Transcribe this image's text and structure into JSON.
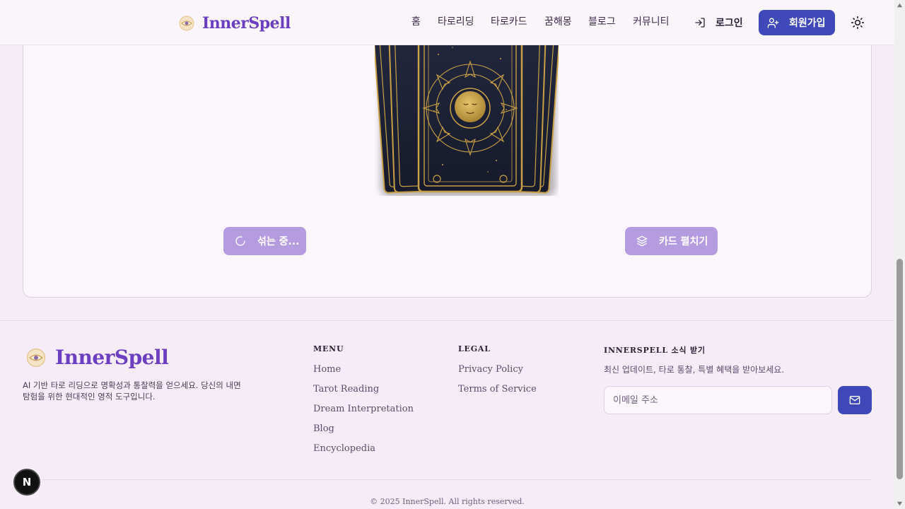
{
  "brand": {
    "name": "InnerSpell"
  },
  "header": {
    "nav": [
      "홈",
      "타로리딩",
      "타로카드",
      "꿈해몽",
      "블로그",
      "커뮤니티"
    ],
    "login_label": "로그인",
    "signup_label": "회원가입"
  },
  "main": {
    "shuffle_label": "섞는 중...",
    "spread_label": "카드 펼치기"
  },
  "footer": {
    "description": "AI 기반 타로 리딩으로 명확성과 통찰력을 얻으세요. 당신의 내면 탐험을 위한 현대적인 영적 도구입니다.",
    "menu": {
      "title": "MENU",
      "links": [
        "Home",
        "Tarot Reading",
        "Dream Interpretation",
        "Blog",
        "Encyclopedia"
      ]
    },
    "legal": {
      "title": "LEGAL",
      "links": [
        "Privacy Policy",
        "Terms of Service"
      ]
    },
    "newsletter": {
      "title": "INNERSPELL 소식 받기",
      "description": "최신 업데이트, 타로 통찰, 특별 혜택을 받아보세요.",
      "placeholder": "이메일 주소"
    },
    "copyright": "© 2025 InnerSpell. All rights reserved."
  },
  "dev_badge": "N",
  "colors": {
    "brand": "#6b3fc0",
    "primary_button": "#3f48b8",
    "disabled_button": "#b59bdf",
    "background": "#f5ecf7",
    "card_gold": "#c9a045",
    "card_navy": "#1b1f33"
  },
  "icons": {
    "logo": "eye-sun-icon",
    "login": "log-in-icon",
    "signup": "user-plus-icon",
    "theme": "sun-icon",
    "shuffle": "loader-icon",
    "spread": "layers-icon",
    "email_submit": "mail-icon"
  }
}
